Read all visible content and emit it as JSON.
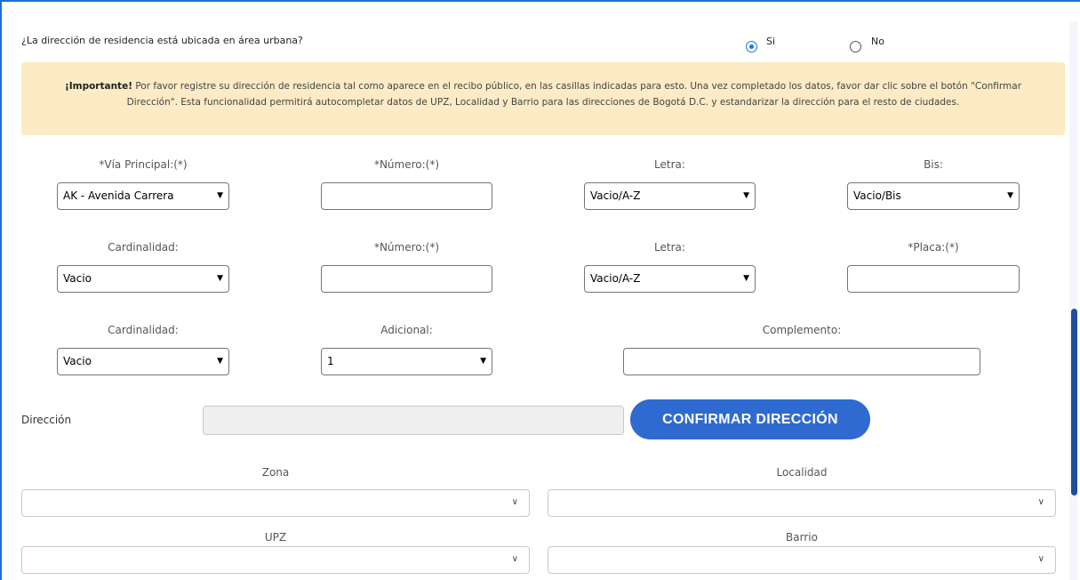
{
  "question": {
    "text": "¿La dirección de residencia está ubicada en área urbana?",
    "options": [
      {
        "label": "Si",
        "checked": true
      },
      {
        "label": "No",
        "checked": false
      }
    ]
  },
  "notice": {
    "bold": "¡Importante!",
    "text": " Por favor registre su dirección de residencia tal como aparece en el recibo público, en las casillas indicadas para esto. Una vez completado los datos, favor dar clic sobre el botón \"Confirmar Dirección\". Esta funcionalidad permitirá autocompletar datos de UPZ, Localidad y Barrio para las direcciones de Bogotá D.C. y estandarizar la dirección para el resto de ciudades."
  },
  "row1": {
    "via_label": "*Vía Principal:(*)",
    "via_value": "AK - Avenida Carrera",
    "numero_label": "*Número:(*)",
    "numero_value": "",
    "letra_label": "Letra:",
    "letra_value": "Vacio/A-Z",
    "bis_label": "Bis:",
    "bis_value": "Vacio/Bis"
  },
  "row2": {
    "cardinalidad_label": "Cardinalidad:",
    "cardinalidad_value": "Vacio",
    "numero_label": "*Número:(*)",
    "numero_value": "",
    "letra_label": "Letra:",
    "letra_value": "Vacio/A-Z",
    "placa_label": "*Placa:(*)",
    "placa_value": ""
  },
  "row3": {
    "cardinalidad_label": "Cardinalidad:",
    "cardinalidad_value": "Vacio",
    "adicional_label": "Adicional:",
    "adicional_value": "1",
    "complemento_label": "Complemento:",
    "complemento_value": ""
  },
  "direccion": {
    "label": "Dirección",
    "value": "",
    "button": "CONFIRMAR DIRECCIÓN"
  },
  "location": {
    "zona_label": "Zona",
    "localidad_label": "Localidad",
    "upz_label": "UPZ",
    "barrio_label": "Barrio"
  },
  "colors": {
    "accent": "#2f6ad0",
    "notice_bg": "#fcebc4",
    "scrollbar": "#1f4e9c"
  }
}
